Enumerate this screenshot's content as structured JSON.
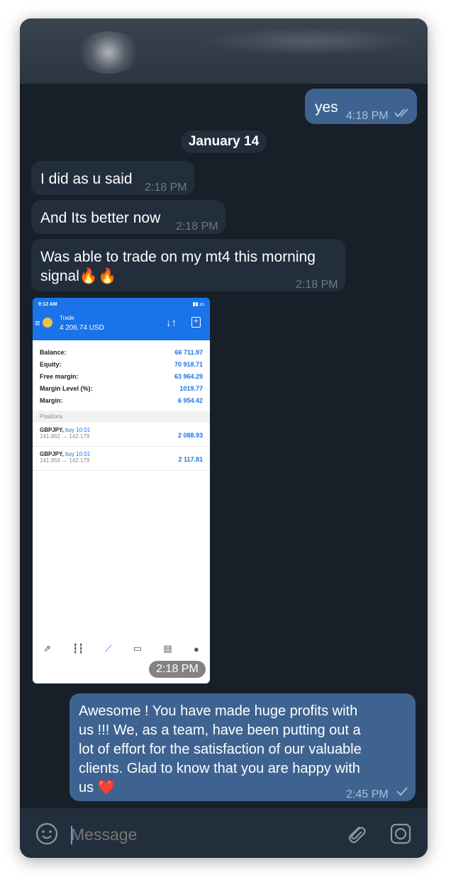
{
  "messages": {
    "yes": {
      "text": "yes",
      "time": "4:18 PM"
    },
    "date": "January 14",
    "m1": {
      "text": "I did as u said",
      "time": "2:18 PM"
    },
    "m2": {
      "text": "And Its better now",
      "time": "2:18 PM"
    },
    "m3": {
      "line1": "Was able to trade on my mt4 this morning",
      "line2": "signal🔥🔥",
      "time": "2:18 PM"
    },
    "photo_time": "2:18 PM",
    "reply": {
      "line1": "Awesome ! You have made huge profits with",
      "line2": "us !!!  We, as a team, have been putting out a",
      "line3": "lot of effort for the satisfaction of our valuable",
      "line4": "clients. Glad to know that you are happy with",
      "line5": "us ❤️",
      "time": "2:45 PM"
    }
  },
  "screenshot": {
    "status_time": "9:12 AM",
    "title": "Trade",
    "balance_header": "4 206.74 USD",
    "rows": [
      {
        "label": "Balance:",
        "value": "66 711.97"
      },
      {
        "label": "Equity:",
        "value": "70 918.71"
      },
      {
        "label": "Free margin:",
        "value": "63 964.29"
      },
      {
        "label": "Margin Level (%):",
        "value": "1019.77"
      },
      {
        "label": "Margin:",
        "value": "6 954.42"
      }
    ],
    "positions_label": "Positions",
    "positions": [
      {
        "symbol": "GBPJPY,",
        "side": "buy 10.01",
        "prices": "141.962 → 142.179",
        "profit": "2 088.93"
      },
      {
        "symbol": "GBPJPY,",
        "side": "buy 10.01",
        "prices": "141.959 → 142.179",
        "profit": "2 117.81"
      }
    ]
  },
  "input": {
    "placeholder": "Message"
  },
  "colors": {
    "background": "#172029",
    "incoming_bubble": "#232e3c",
    "outgoing_bubble": "#3e6390",
    "mt4_blue": "#1a73e8"
  }
}
